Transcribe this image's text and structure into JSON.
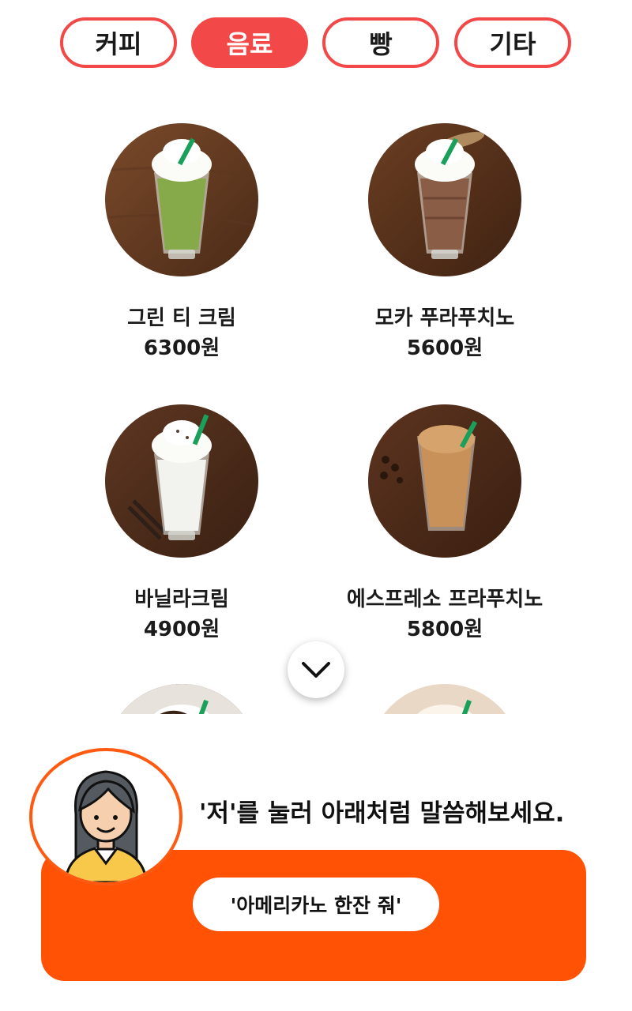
{
  "tabs": [
    {
      "label": "커피",
      "active": false
    },
    {
      "label": "음료",
      "active": true
    },
    {
      "label": "빵",
      "active": false
    },
    {
      "label": "기타",
      "active": false
    }
  ],
  "products": [
    {
      "name": "그린 티 크림",
      "price": "6300원",
      "image": "green-tea-frappe"
    },
    {
      "name": "모카 푸라푸치노",
      "price": "5600원",
      "image": "mocha-frappe"
    },
    {
      "name": "바닐라크림",
      "price": "4900원",
      "image": "vanilla-cream-frappe"
    },
    {
      "name": "에스프레소 프라푸치노",
      "price": "5800원",
      "image": "espresso-frappe"
    }
  ],
  "scroll_icon": "chevron-down-icon",
  "assistant": {
    "hint": "'저'를 눌러 아래처럼 말씀해보세요.",
    "sample_phrase": "'아메리카노 한잔 줘'",
    "avatar_icon": "woman-avatar-icon"
  },
  "colors": {
    "tab_accent": "#f24848",
    "panel": "#ff5205",
    "avatar_border": "#ff5a12"
  }
}
